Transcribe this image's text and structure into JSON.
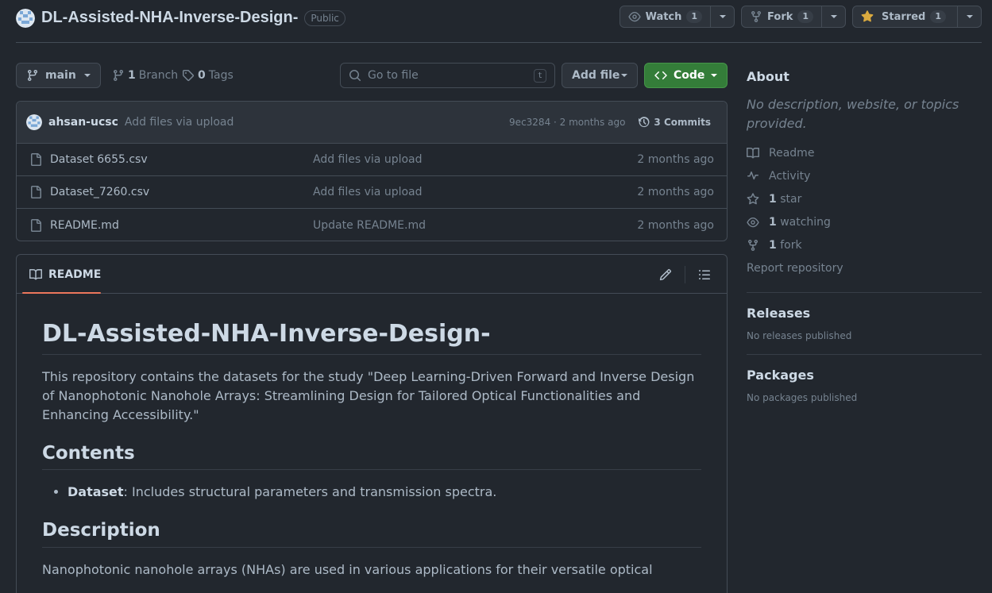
{
  "repo": {
    "name": "DL-Assisted-NHA-Inverse-Design-",
    "visibility": "Public",
    "watch_label": "Watch",
    "watch_count": "1",
    "fork_label": "Fork",
    "fork_count": "1",
    "star_label": "Starred",
    "star_count": "1"
  },
  "toolbar": {
    "branch": "main",
    "branches_count": "1",
    "branches_label": "Branch",
    "tags_count": "0",
    "tags_label": "Tags",
    "goto_placeholder": "Go to file",
    "goto_shortcut": "t",
    "add_file": "Add file",
    "code": "Code"
  },
  "commit": {
    "author": "ahsan-ucsc",
    "message": "Add files via upload",
    "meta": "9ec3284 · 2 months ago",
    "commits": "3 Commits"
  },
  "files": [
    {
      "name": "Dataset 6655.csv",
      "message": "Add files via upload",
      "date": "2 months ago"
    },
    {
      "name": "Dataset_7260.csv",
      "message": "Add files via upload",
      "date": "2 months ago"
    },
    {
      "name": "README.md",
      "message": "Update README.md",
      "date": "2 months ago"
    }
  ],
  "readme": {
    "tab": "README",
    "h1": "DL-Assisted-NHA-Inverse-Design-",
    "intro": "This repository contains the datasets for the study \"Deep Learning-Driven Forward and Inverse Design of Nanophotonic Nanohole Arrays: Streamlining Design for Tailored Optical Functionalities and Enhancing Accessibility.\"",
    "contents_heading": "Contents",
    "bullet_term": "Dataset",
    "bullet_text": ": Includes structural parameters and transmission spectra.",
    "description_heading": "Description",
    "description": "Nanophotonic nanohole arrays (NHAs) are used in various applications for their versatile optical"
  },
  "sidebar": {
    "about_title": "About",
    "about_desc": "No description, website, or topics provided.",
    "readme": "Readme",
    "activity": "Activity",
    "stars_count": "1",
    "stars_label": "star",
    "watching_count": "1",
    "watching_label": "watching",
    "forks_count": "1",
    "forks_label": "fork",
    "report": "Report repository",
    "releases_title": "Releases",
    "releases_text": "No releases published",
    "packages_title": "Packages",
    "packages_text": "No packages published"
  },
  "colors": {
    "background": "#22272e",
    "accent_green": "#347d39",
    "tab_underline": "#ec775c",
    "star": "#daaa3f"
  }
}
